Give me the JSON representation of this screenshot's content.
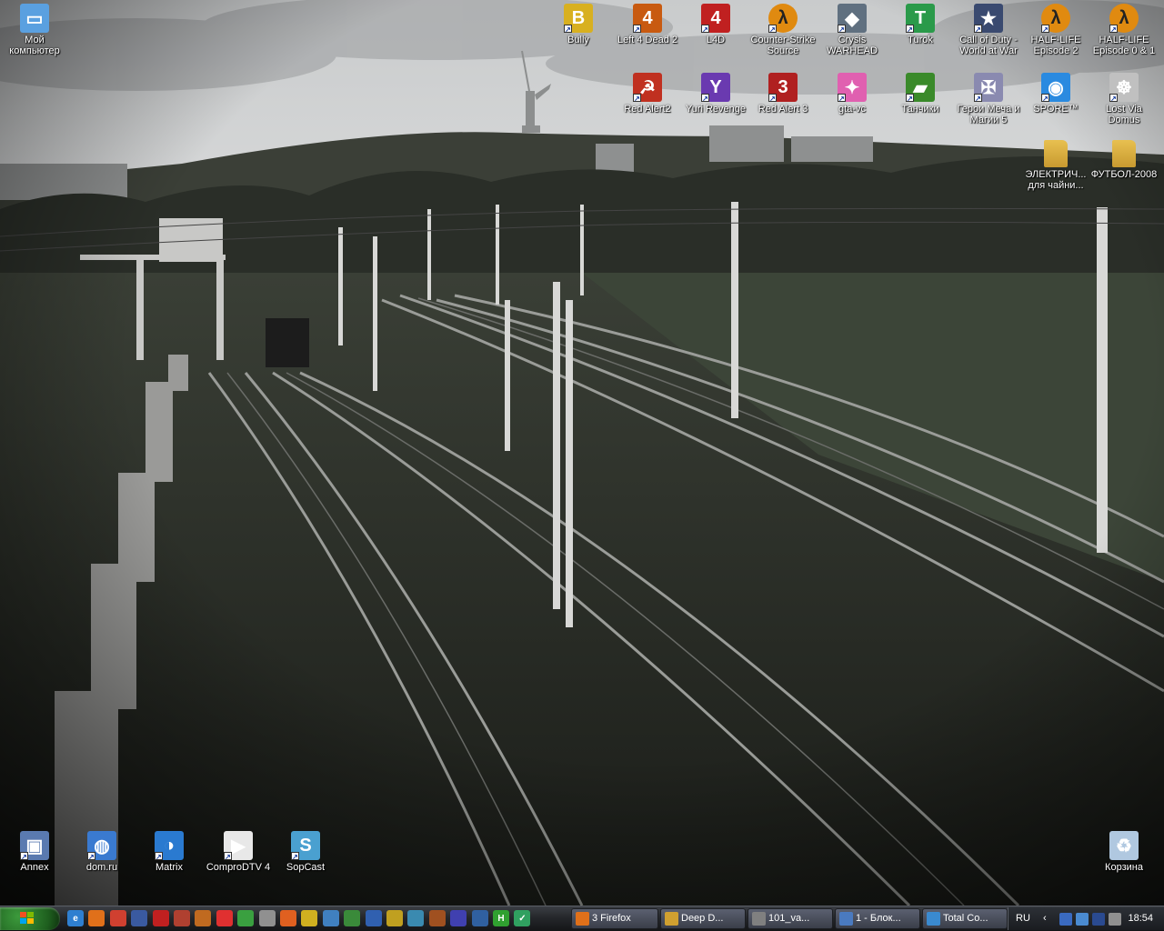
{
  "colors": {
    "taskbar": "#25272b",
    "accent": "#2f7fd0",
    "start": "#2e7d2e"
  },
  "desktop_icons": [
    {
      "id": "my-computer",
      "label": "Мой компьютер",
      "icon": "computer-icon",
      "color": "#5aa0e0"
    },
    {
      "id": "bully",
      "label": "Bully",
      "icon": "bully-game-icon",
      "color": "#d8b020"
    },
    {
      "id": "left4dead2",
      "label": "Left 4 Dead 2",
      "icon": "left4dead2-icon",
      "color": "#c85a10"
    },
    {
      "id": "l4d",
      "label": "L4D",
      "icon": "l4d-icon",
      "color": "#c02020"
    },
    {
      "id": "counter-strike",
      "label": "Counter-Strike Source",
      "icon": "half-life-lambda-icon",
      "color": "#e08a10"
    },
    {
      "id": "crysis",
      "label": "Crysis WARHEAD",
      "icon": "crysis-icon",
      "color": "#607080"
    },
    {
      "id": "turok",
      "label": "Turok",
      "icon": "turok-icon",
      "color": "#2a9a4a"
    },
    {
      "id": "cod",
      "label": "Call of Duty - World at War",
      "icon": "call-of-duty-icon",
      "color": "#3a4a70"
    },
    {
      "id": "hl2ep2",
      "label": "HALF-LIFE Episode 2",
      "icon": "half-life-lambda-icon",
      "color": "#e08a10"
    },
    {
      "id": "hl2ep01",
      "label": "HALF-LIFE Episode 0 & 1",
      "icon": "half-life-lambda-icon",
      "color": "#e08a10"
    },
    {
      "id": "redalert2",
      "label": "Red Alert2",
      "icon": "red-alert-icon",
      "color": "#c03020"
    },
    {
      "id": "yuri",
      "label": "Yuri Revenge",
      "icon": "yuri-revenge-icon",
      "color": "#6a3ab0"
    },
    {
      "id": "redalert3",
      "label": "Red Alert 3",
      "icon": "red-alert3-icon",
      "color": "#b02020"
    },
    {
      "id": "gtavc",
      "label": "gta-vc",
      "icon": "gta-vc-icon",
      "color": "#e060b0"
    },
    {
      "id": "tanchiki",
      "label": "Танчики",
      "icon": "tank-icon",
      "color": "#3a8a2a"
    },
    {
      "id": "heroes5",
      "label": "Герои Меча и Магии 5",
      "icon": "heroes-icon",
      "color": "#8a8ab0"
    },
    {
      "id": "spore",
      "label": "SPORE™",
      "icon": "spore-icon",
      "color": "#2a8ae0"
    },
    {
      "id": "lostvia",
      "label": "Lost Via Domus",
      "icon": "dharma-icon",
      "color": "#c0c0c0"
    },
    {
      "id": "electric",
      "label": "ЭЛЕКТРИЧ... для чайни...",
      "icon": "folder-icon",
      "color": "#e8c050"
    },
    {
      "id": "football",
      "label": "ФУТБОЛ-2008",
      "icon": "folder-icon",
      "color": "#e8c050"
    },
    {
      "id": "annex",
      "label": "Annex",
      "icon": "network-computer-icon",
      "color": "#5a7ab0"
    },
    {
      "id": "domru",
      "label": "dom.ru",
      "icon": "network-globe-icon",
      "color": "#3a7ad0"
    },
    {
      "id": "matrix",
      "label": "Matrix",
      "icon": "matrix-icon",
      "color": "#2a7ad0"
    },
    {
      "id": "comprodtv",
      "label": "ComproDTV 4",
      "icon": "tv-icon",
      "color": "#e8e8e8"
    },
    {
      "id": "sopcast",
      "label": "SopCast",
      "icon": "sopcast-icon",
      "color": "#4aa0d0"
    },
    {
      "id": "recycle",
      "label": "Корзина",
      "icon": "recycle-bin-icon",
      "color": "#b0c8e0"
    }
  ],
  "taskbar": {
    "quick_launch": [
      {
        "name": "ie-icon",
        "color": "#2f7fd0",
        "glyph": "e"
      },
      {
        "name": "firefox-icon",
        "color": "#e0701a",
        "glyph": ""
      },
      {
        "name": "chrome-icon",
        "color": "#d04030",
        "glyph": ""
      },
      {
        "name": "save-icon",
        "color": "#3a5aa0",
        "glyph": ""
      },
      {
        "name": "acrobat-icon",
        "color": "#c02020",
        "glyph": ""
      },
      {
        "name": "app-icon",
        "color": "#b04030",
        "glyph": ""
      },
      {
        "name": "home-icon",
        "color": "#c06a20",
        "glyph": ""
      },
      {
        "name": "grid-icon",
        "color": "#e03030",
        "glyph": ""
      },
      {
        "name": "green-app-icon",
        "color": "#3aa040",
        "glyph": ""
      },
      {
        "name": "music-icon",
        "color": "#909090",
        "glyph": ""
      },
      {
        "name": "tool-icon",
        "color": "#e06020",
        "glyph": ""
      },
      {
        "name": "media-icon",
        "color": "#d0b020",
        "glyph": ""
      },
      {
        "name": "photo-icon",
        "color": "#4080c0",
        "glyph": ""
      },
      {
        "name": "excel-icon",
        "color": "#3a8a3a",
        "glyph": ""
      },
      {
        "name": "chart-icon",
        "color": "#3060b0",
        "glyph": ""
      },
      {
        "name": "chess-icon",
        "color": "#c0a020",
        "glyph": ""
      },
      {
        "name": "winamp-icon",
        "color": "#3a8ab0",
        "glyph": ""
      },
      {
        "name": "film-icon",
        "color": "#a05020",
        "glyph": ""
      },
      {
        "name": "blue-app-icon",
        "color": "#4040b0",
        "glyph": ""
      },
      {
        "name": "disk-icon",
        "color": "#3060a0",
        "glyph": ""
      },
      {
        "name": "h-icon",
        "color": "#30a030",
        "glyph": "H"
      },
      {
        "name": "check-icon",
        "color": "#30a060",
        "glyph": "✓"
      }
    ],
    "tasks": [
      {
        "name": "task-firefox",
        "label": "3 Firefox",
        "color": "#e0701a"
      },
      {
        "name": "task-deep",
        "label": "Deep D...",
        "color": "#d0a030"
      },
      {
        "name": "task-101",
        "label": "101_va...",
        "color": "#808080"
      },
      {
        "name": "task-notepad",
        "label": "1 - Блок...",
        "color": "#4a7ac0"
      },
      {
        "name": "task-totalcmd",
        "label": "Total Co...",
        "color": "#3a8ad0"
      }
    ],
    "language": "RU",
    "clock": "18:54"
  }
}
